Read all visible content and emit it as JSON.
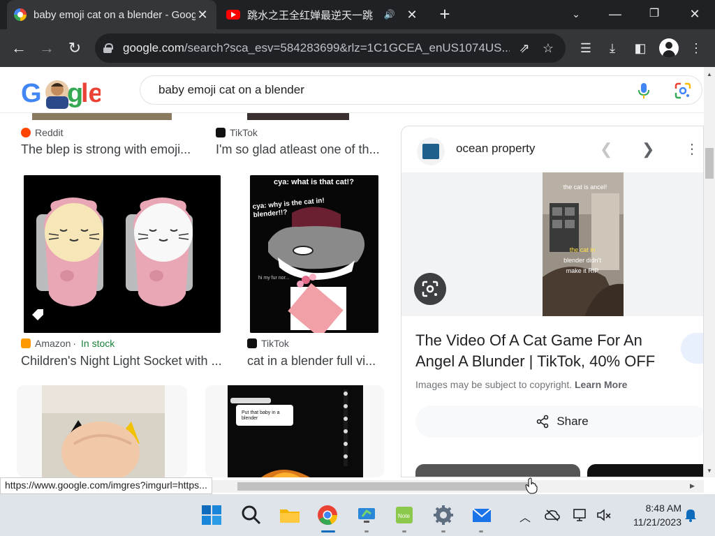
{
  "browser": {
    "tabs": [
      {
        "title": "baby emoji cat on a blender - Google Search",
        "active": true
      },
      {
        "title": "跳水之王全红婵最逆天一跳",
        "active": false
      }
    ],
    "url_host": "google.com",
    "url_rest": "/search?sca_esv=584283699&rlz=1C1GCEA_enUS1074US..."
  },
  "search": {
    "query": "baby emoji cat on a blender"
  },
  "results": [
    {
      "source": "Reddit",
      "caption": "The blep is strong with emoji..."
    },
    {
      "source": "TikTok",
      "caption": "I'm so glad atleast one of th..."
    },
    {
      "source": "Amazon",
      "stock": "In stock",
      "caption": "Children's Night Light Socket with ..."
    },
    {
      "source": "TikTok",
      "caption": "cat in a blender full vi..."
    }
  ],
  "tiktok_overlay": {
    "line1": "cya: what is that cat!?",
    "line2": "cya: why is the cat in! blender!!?",
    "line3": "hi my fur nor..."
  },
  "tiktok_comment": {
    "text": "Put that baby in a blender"
  },
  "panel": {
    "site": "ocean property",
    "preview_lines": [
      "the cat is ancel!",
      "the cat in",
      "blender didn't",
      "make it RIP"
    ],
    "title": "The Video Of A Cat Game For An Angel A Blunder | TikTok, 40% OFF",
    "copyright": "Images may be subject to copyright.",
    "learn_more": "Learn More",
    "share": "Share"
  },
  "status_url": "https://www.google.com/imgres?imgurl=https...",
  "clock": {
    "time": "8:48 AM",
    "date": "11/21/2023"
  }
}
